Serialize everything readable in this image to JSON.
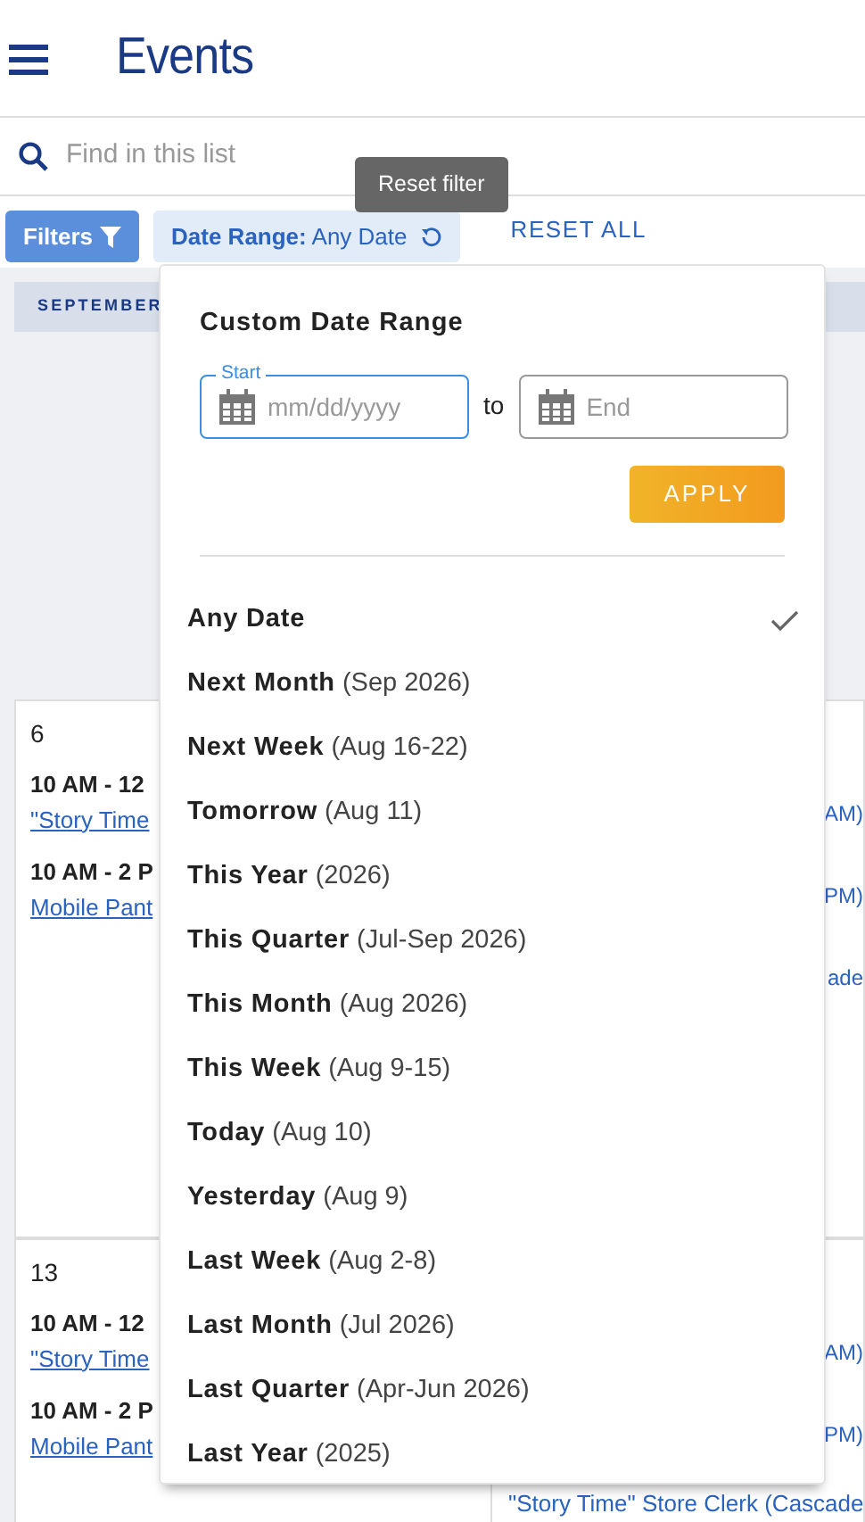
{
  "header": {
    "title": "Events"
  },
  "search": {
    "placeholder": "Find in this list"
  },
  "toolbar": {
    "filters_button": "Filters",
    "chip": {
      "label": "Date Range:",
      "value": "Any Date"
    },
    "reset_all": "RESET ALL",
    "tooltip": "Reset filter"
  },
  "month": "SEPTEMBER",
  "weeks": [
    {
      "day": "6",
      "events": [
        {
          "time": "10 AM - 12",
          "title": "\"Story Time"
        },
        {
          "time": "10 AM - 2 P",
          "title": "Mobile Pant"
        }
      ],
      "right": [
        "AM)",
        "PM)",
        "ade"
      ]
    },
    {
      "day": "13",
      "events": [
        {
          "time": "10 AM - 12",
          "title": "\"Story Time"
        },
        {
          "time": "10 AM - 2 P",
          "title": "Mobile Pant"
        }
      ],
      "right": [
        "AM)",
        "PM)"
      ],
      "last_event": {
        "title": "\"Story Time\" Store Clerk (Cascade"
      }
    }
  ],
  "dropdown": {
    "title": "Custom Date Range",
    "start": {
      "label": "Start",
      "placeholder": "mm/dd/yyyy"
    },
    "to": "to",
    "end": {
      "placeholder": "End"
    },
    "apply": "APPLY",
    "options": [
      {
        "name": "Any Date",
        "selected": true
      },
      {
        "name": "Next Month",
        "detail": "(Sep 2026)",
        "selected": false
      },
      {
        "name": "Next Week",
        "detail": "(Aug 16-22)",
        "selected": false
      },
      {
        "name": "Tomorrow",
        "detail": "(Aug 11)",
        "selected": false
      },
      {
        "name": "This Year",
        "detail": "(2026)",
        "selected": false
      },
      {
        "name": "This Quarter",
        "detail": "(Jul-Sep 2026)",
        "selected": false
      },
      {
        "name": "This Month",
        "detail": "(Aug 2026)",
        "selected": false
      },
      {
        "name": "This Week",
        "detail": "(Aug 9-15)",
        "selected": false
      },
      {
        "name": "Today",
        "detail": "(Aug 10)",
        "selected": false
      },
      {
        "name": "Yesterday",
        "detail": "(Aug 9)",
        "selected": false
      },
      {
        "name": "Last Week",
        "detail": "(Aug 2-8)",
        "selected": false
      },
      {
        "name": "Last Month",
        "detail": "(Jul 2026)",
        "selected": false
      },
      {
        "name": "Last Quarter",
        "detail": "(Apr-Jun 2026)",
        "selected": false
      },
      {
        "name": "Last Year",
        "detail": "(2025)",
        "selected": false
      }
    ]
  }
}
